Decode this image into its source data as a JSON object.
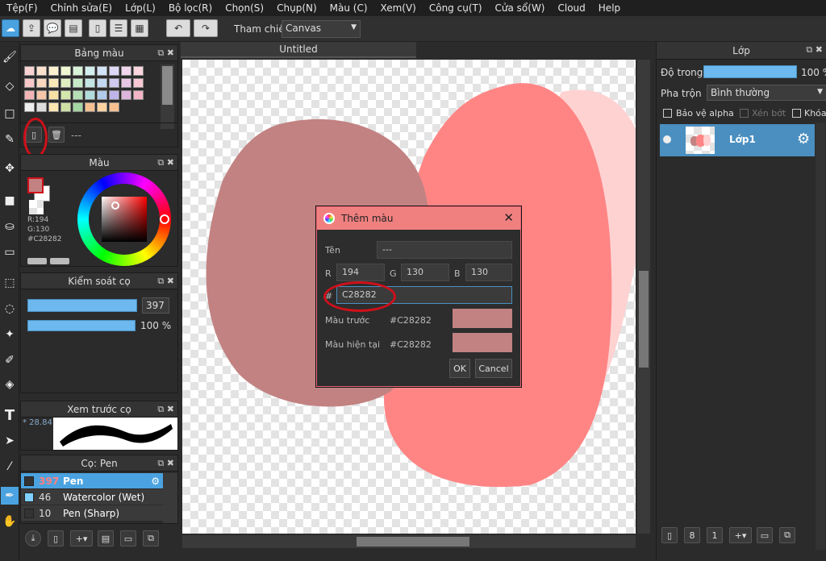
{
  "menu": [
    "Tệp(F)",
    "Chỉnh sửa(E)",
    "Lớp(L)",
    "Bộ lọc(R)",
    "Chọn(S)",
    "Chụp(N)",
    "Màu (C)",
    "Xem(V)",
    "Công cụ(T)",
    "Cửa sổ(W)",
    "Cloud",
    "Help"
  ],
  "toolbar": {
    "ref_label": "Tham chiếu",
    "ref_value": "Canvas"
  },
  "palette": {
    "title": "Bảng màu",
    "name_value": "---"
  },
  "color_panel": {
    "title": "Màu",
    "r": "R:194",
    "g": "G:130",
    "hex": "#C28282"
  },
  "brush_control": {
    "title": "Kiểm soát cọ",
    "size": "397",
    "opacity": "100 %"
  },
  "brush_preview": {
    "title": "Xem trước cọ",
    "value": "* 28.84"
  },
  "brush_list": {
    "title": "Cọ: Pen",
    "items": [
      {
        "size": "397",
        "name": "Pen",
        "selected": true,
        "color": "#333333"
      },
      {
        "size": "46",
        "name": "Watercolor (Wet)",
        "selected": false,
        "color": "#7fd0ff"
      },
      {
        "size": "10",
        "name": "Pen (Sharp)",
        "selected": false,
        "color": "#333333"
      }
    ]
  },
  "canvas": {
    "tab": "Untitled",
    "shape_colors": [
      "#c28282",
      "#ff8585",
      "#ffd2d2"
    ]
  },
  "dialog": {
    "title": "Thêm màu",
    "name_label": "Tên",
    "name_value": "---",
    "r_label": "R",
    "r_value": "194",
    "g_label": "G",
    "g_value": "130",
    "b_label": "B",
    "b_value": "130",
    "hash_label": "#",
    "hex_value": "C28282",
    "prev_label": "Màu trước",
    "prev_hex": "#C28282",
    "curr_label": "Màu hiện tại",
    "curr_hex": "#C28282",
    "ok": "OK",
    "cancel": "Cancel",
    "swatch_color": "#c28282"
  },
  "layers": {
    "title": "Lớp",
    "opacity_label": "Độ trong",
    "opacity_value": "100 %",
    "opacity_fraction": 1.0,
    "blend_label": "Pha trộn",
    "blend_value": "Bình thường",
    "protect_alpha": "Bảo vệ alpha",
    "clip": "Xén bớt",
    "lock": "Khóa",
    "layer_name": "Lớp1"
  },
  "accent_color": "#4aa3e0"
}
